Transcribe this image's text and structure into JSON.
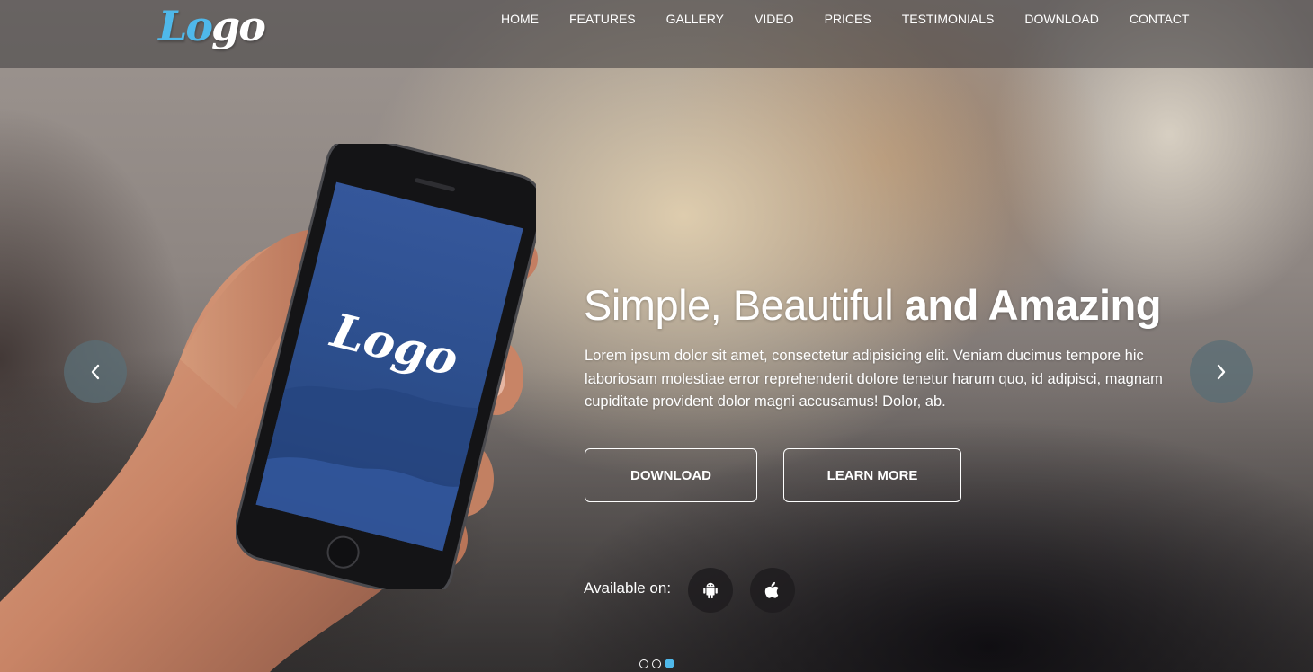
{
  "header": {
    "logo": {
      "part1": "Lo",
      "part2": "go"
    },
    "nav": [
      {
        "label": "HOME"
      },
      {
        "label": "FEATURES"
      },
      {
        "label": "GALLERY"
      },
      {
        "label": "VIDEO"
      },
      {
        "label": "PRICES"
      },
      {
        "label": "TESTIMONIALS"
      },
      {
        "label": "DOWNLOAD"
      },
      {
        "label": "CONTACT"
      }
    ]
  },
  "hero": {
    "title_light": "Simple, Beautiful ",
    "title_bold": "and Amazing",
    "text": "Lorem ipsum dolor sit amet, consectetur adipisicing elit. Veniam ducimus tempore hic laboriosam molestiae error reprehenderit dolore tenetur harum quo, id adipisci, magnam cupiditate provident dolor magni accusamus! Dolor, ab.",
    "download_label": "DOWNLOAD",
    "learn_more_label": "LEARN MORE",
    "available_label": "Available on:",
    "phone_logo": "Logo"
  },
  "carousel": {
    "slide_count": 3,
    "active_slide": 3
  },
  "colors": {
    "accent": "#4fb8ea",
    "phone_screen": "#2c4f8c"
  },
  "icons": {
    "prev": "chevron-left-icon",
    "next": "chevron-right-icon",
    "android": "android-icon",
    "apple": "apple-icon"
  }
}
